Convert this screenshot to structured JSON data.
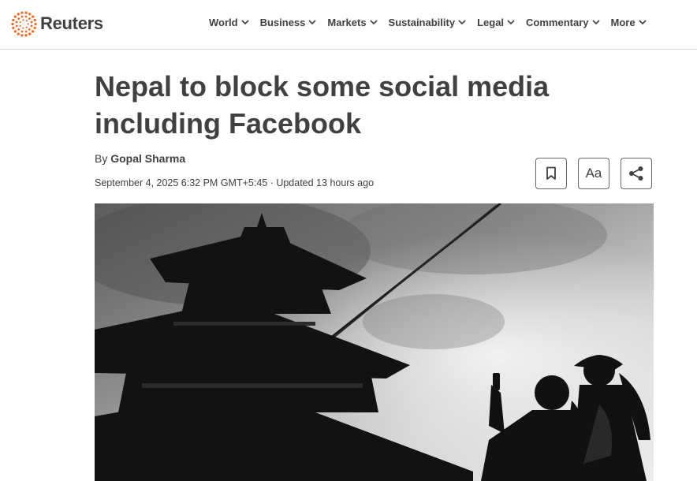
{
  "brand": {
    "name": "Reuters",
    "color": "#f26722",
    "logo_icon": "reuters-dot-ring-icon"
  },
  "nav": [
    {
      "label": "World"
    },
    {
      "label": "Business"
    },
    {
      "label": "Markets"
    },
    {
      "label": "Sustainability"
    },
    {
      "label": "Legal"
    },
    {
      "label": "Commentary"
    },
    {
      "label": "More"
    }
  ],
  "article": {
    "title": "Nepal to block some social media including Facebook",
    "byline_prefix": "By",
    "author": "Gopal Sharma",
    "dateline": "September 4, 2025 6:32 PM GMT+5:45 · Updated 13 hours ago"
  },
  "tools": {
    "bookmark_icon": "bookmark-icon",
    "text_size_label": "Aa",
    "share_icon": "share-icon"
  },
  "image": {
    "description_icon": "lead-photo"
  }
}
